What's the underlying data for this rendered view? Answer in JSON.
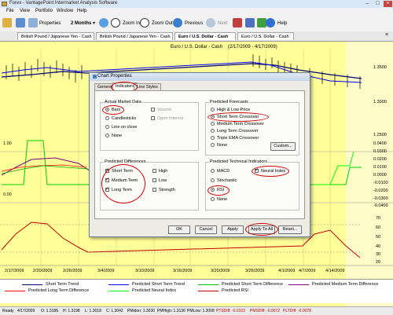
{
  "window": {
    "title": "Forex - VantagePoint Intermarket Analysis Software"
  },
  "menu": [
    "File",
    "View",
    "Portfolio",
    "Window",
    "Help"
  ],
  "toolbar": {
    "properties": "Properties",
    "period": "2 Months",
    "zoom_in": "Zoom In",
    "zoom_out": "Zoom Out",
    "previous": "Previous",
    "next": "Next",
    "help": "Help"
  },
  "tabs": [
    {
      "label": "British Pound / Japanese Yen - Cash"
    },
    {
      "label": "British Pound / Japanese Yen - Cash"
    },
    {
      "label": "Euro / U.S. Dollar - Cash"
    },
    {
      "label": "Euro / U.S. Dollar - Cash"
    }
  ],
  "chart": {
    "title": "Euro / U.S. Dollar - Cash",
    "date_range": "(2/17/2009 - 4/17/2009)",
    "left_ticks": [
      "1.00",
      "0.00"
    ],
    "right_price_ticks": [
      "1.3500",
      "1.3000",
      "1.2500"
    ],
    "right_diff_ticks": [
      "0.0400",
      "0.0300",
      "0.0200",
      "0.0100",
      "0.0000",
      "-0.0100",
      "-0.0200",
      "-0.0300",
      "-0.0400"
    ],
    "right_rsi_ticks": [
      "70",
      "60",
      "50",
      "40",
      "30",
      "20"
    ],
    "x_ticks": [
      "2/17/2009",
      "2/20/2009",
      "2/26/2009",
      "3/4/2009",
      "3/10/2009",
      "3/16/2009",
      "3/20/2009",
      "3/26/2009",
      "4/1/2009",
      "4/7/2009",
      "4/14/2009"
    ]
  },
  "dialog": {
    "title": "Chart Properties",
    "tabs": [
      "General",
      "Indicators",
      "Line Styles"
    ],
    "actual_market_data": {
      "label": "Actual Market Data",
      "options": [
        {
          "label": "Bars",
          "selected": true
        },
        {
          "label": "Candlesticks",
          "selected": false
        },
        {
          "label": "Line on close",
          "selected": false
        },
        {
          "label": "None",
          "selected": false
        }
      ],
      "volume": "Volume",
      "open_interest": "Open Interest"
    },
    "predicted_forecasts": {
      "label": "Predicted Forecasts",
      "options": [
        {
          "label": "High & Low Price",
          "selected": false
        },
        {
          "label": "Short Term Crossover",
          "selected": true
        },
        {
          "label": "Medium Term Crossover",
          "selected": false
        },
        {
          "label": "Long Term Crossover",
          "selected": false
        },
        {
          "label": "Triple EMA Crossover",
          "selected": false
        },
        {
          "label": "None",
          "selected": false
        }
      ],
      "custom_button": "Custom..."
    },
    "predicted_differences": {
      "label": "Predicted Differences",
      "left": [
        {
          "label": "Short Term",
          "checked": true
        },
        {
          "label": "Medium Term",
          "checked": true
        },
        {
          "label": "Long Term",
          "checked": true
        }
      ],
      "right": [
        {
          "label": "High",
          "checked": false
        },
        {
          "label": "Low",
          "checked": false
        },
        {
          "label": "Strength",
          "checked": false
        }
      ]
    },
    "predicted_technical": {
      "label": "Predicted Technical Indicators",
      "options": [
        {
          "label": "MACD",
          "selected": false
        },
        {
          "label": "Stochastic",
          "selected": false
        },
        {
          "label": "RSI",
          "selected": true
        },
        {
          "label": "None",
          "selected": false
        }
      ],
      "neural_index": {
        "label": "Neural Index",
        "checked": true
      }
    },
    "buttons": {
      "ok": "OK",
      "cancel": "Cancel",
      "apply": "Apply",
      "apply_to_all": "Apply To All",
      "reset": "Reset..."
    }
  },
  "legend": [
    {
      "label": "Short Term Trend",
      "color": "#000080"
    },
    {
      "label": "Predicted Short Term Trend",
      "color": "#0000ff"
    },
    {
      "label": "Predicted Short Term Difference",
      "color": "#00c000"
    },
    {
      "label": "Predicted Medium Term Difference",
      "color": "#800080"
    },
    {
      "label": "Predicted Long Term Difference",
      "color": "#ff0000"
    },
    {
      "label": "Predicted Neural Index",
      "color": "#00ff00"
    },
    {
      "label": "Predicted RSI",
      "color": "#c00000"
    }
  ],
  "status": {
    "ready": "Ready",
    "date": "4/17/2009",
    "open": "O: 1.3185",
    "high": "H: 1.3198",
    "low": "L: 1.3018",
    "close": "C: 1.3042",
    "pmidon": "PMidon: 1.3030",
    "pmhigh": "PMHigh: 1.3136",
    "pmlow": "PMLow: 1.3008",
    "ptsdiff": "PTSDiff: -0.0103",
    "pmsdiff": "PMSDiff: -0.0072",
    "pltdiff": "PLTDiff: -0.0078"
  }
}
